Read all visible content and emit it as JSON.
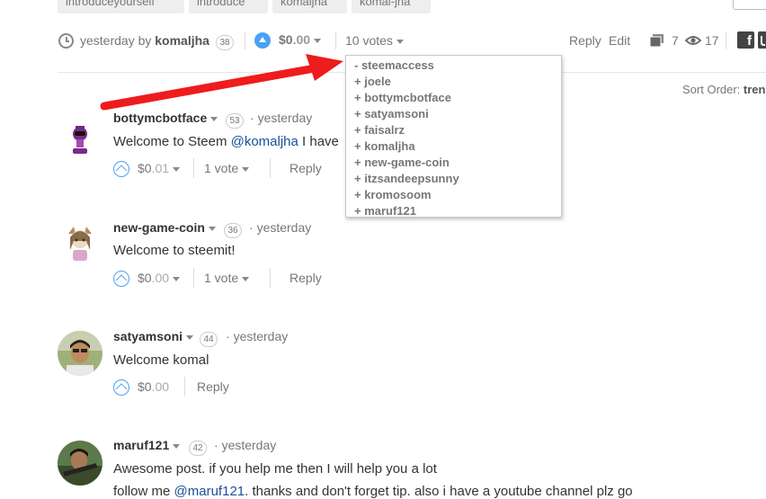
{
  "tags": [
    "introduceyourself",
    "introduce",
    "komaljha",
    "komal-jha"
  ],
  "post": {
    "time": "yesterday by",
    "author": "komaljha",
    "reputation": "38",
    "payout_main": "$0",
    "payout_cents": ".00",
    "votes_label": "10 votes",
    "reply_label": "Reply",
    "edit_label": "Edit",
    "comment_count": "7",
    "view_count": "17"
  },
  "voters": [
    "- steemaccess",
    "+ joele",
    "+ bottymcbotface",
    "+ satyamsoni",
    "+ faisalrz",
    "+ komaljha",
    "+ new-game-coin",
    "+ itzsandeepsunny",
    "+ kromosoom",
    "+ maruf121"
  ],
  "sort_order": {
    "label": "Sort Order:",
    "value": "trending"
  },
  "comments": [
    {
      "author": "bottymcbotface",
      "rep": "53",
      "time": "yesterday",
      "text_before": "Welcome to Steem ",
      "mention": "@komaljha",
      "text_after": " I have",
      "payout_main": "$0",
      "payout_cents": ".01",
      "votes": "1 vote",
      "reply": "Reply"
    },
    {
      "author": "new-game-coin",
      "rep": "36",
      "time": "yesterday",
      "text": "Welcome to steemit!",
      "payout_main": "$0",
      "payout_cents": ".00",
      "votes": "1 vote",
      "reply": "Reply"
    },
    {
      "author": "satyamsoni",
      "rep": "44",
      "time": "yesterday",
      "text": "Welcome komal",
      "payout_main": "$0",
      "payout_cents": ".00",
      "reply": "Reply"
    },
    {
      "author": "maruf121",
      "rep": "42",
      "time": "yesterday",
      "text": "Awesome post. if you help me then I will help you a lot",
      "line2_before": "follow me ",
      "mention": "@maruf121",
      "line2_after": ". thanks and don't forget tip. also i have a youtube channel plz go"
    }
  ],
  "bullet": "·",
  "colors": {
    "accent_blue": "#4ba2f2",
    "link": "#1a5099",
    "arrow_red": "#ee1c1c"
  }
}
